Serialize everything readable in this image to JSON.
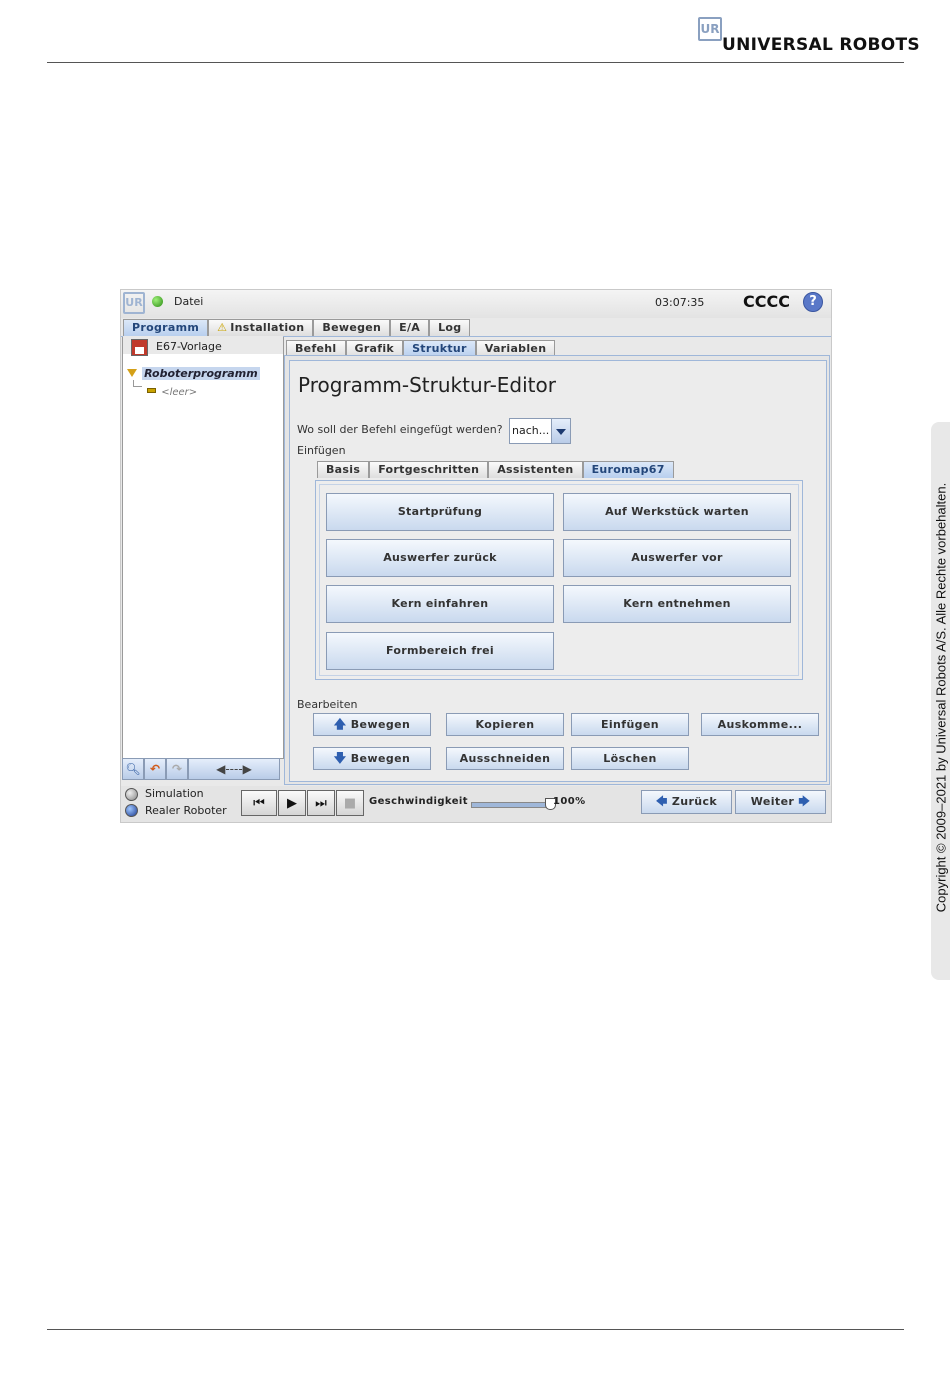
{
  "page": {
    "brand": "UNIVERSAL ROBOTS",
    "logo_mark": "UR",
    "copyright": "Copyright © 2009–2021 by Universal Robots A/S. Alle Rechte vorbehalten."
  },
  "app": {
    "menu_file": "Datei",
    "clock": "03:07:35",
    "robot_name": "CCCC",
    "help_glyph": "?",
    "main_tabs": [
      "Programm",
      "Installation",
      "Bewegen",
      "E/A",
      "Log"
    ],
    "active_main_tab": "Programm",
    "installation_warning_icon": "warning-icon"
  },
  "left_panel": {
    "file_name": "E67-Vorlage",
    "tree_root": "Roboterprogramm",
    "tree_child": "<leer>",
    "toolbar_icons": [
      "search-icon",
      "undo-icon",
      "redo-icon",
      "move-arrows-icon"
    ]
  },
  "sub_tabs": [
    "Befehl",
    "Grafik",
    "Struktur",
    "Variablen"
  ],
  "active_sub_tab": "Struktur",
  "editor": {
    "title": "Programm-Struktur-Editor",
    "insert_question": "Wo soll der Befehl eingefügt werden?",
    "insert_position_value": "nach...",
    "insert_label": "Einfügen",
    "insert_tabs": [
      "Basis",
      "Fortgeschritten",
      "Assistenten",
      "Euromap67"
    ],
    "active_insert_tab": "Euromap67",
    "euromap_buttons": [
      "Startprüfung",
      "Auf Werkstück warten",
      "Auswerfer zurück",
      "Auswerfer vor",
      "Kern einfahren",
      "Kern entnehmen",
      "Formbereich frei"
    ],
    "edit_label": "Bearbeiten",
    "edit_buttons": {
      "move_up": "Bewegen",
      "copy": "Kopieren",
      "paste": "Einfügen",
      "comment": "Auskomme...",
      "move_down": "Bewegen",
      "cut": "Ausschneiden",
      "delete": "Löschen"
    }
  },
  "bottom_bar": {
    "simulation": "Simulation",
    "real_robot": "Realer Roboter",
    "selected_mode": "Realer Roboter",
    "speed_label": "Geschwindigkeit",
    "speed_value": "100%",
    "speed_fraction": 1.0,
    "back": "Zurück",
    "next": "Weiter"
  },
  "colors": {
    "accent_blue": "#9fb7d9",
    "active_tab": "#b8cfee",
    "button_gradient_end": "#c9d9ee"
  }
}
